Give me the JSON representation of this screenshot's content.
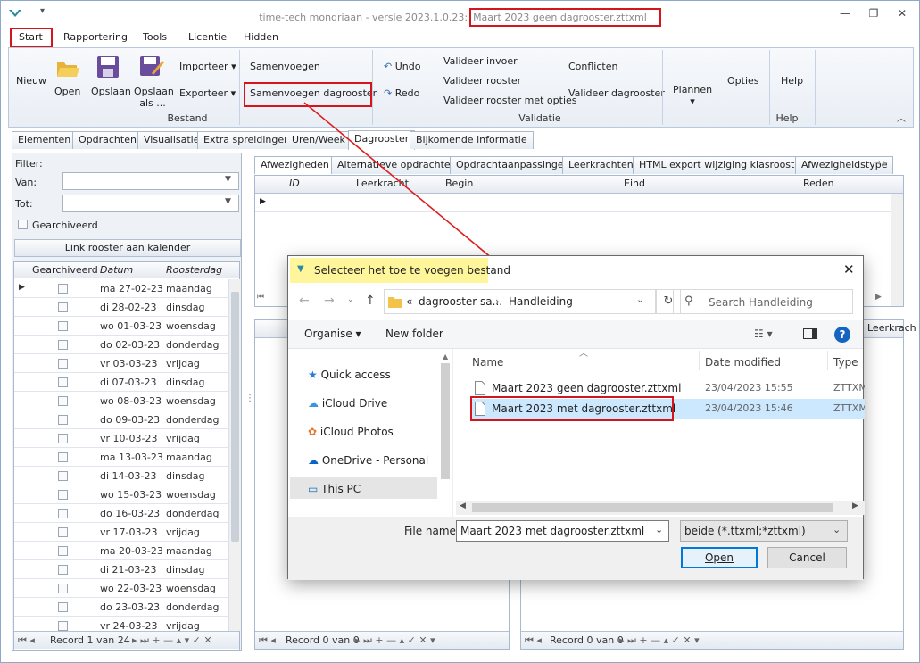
{
  "window": {
    "title": "time-tech mondriaan - versie 2023.1.0.23: Maart 2023 geen dagrooster.zttxml",
    "title_prefix": "time-tech mondriaan - versie 2023.1.0.23:",
    "title_file": "Maart 2023 geen dagrooster.zttxml",
    "minimize": "—",
    "restore": "❐",
    "close": "✕"
  },
  "menu": [
    "Start",
    "Rapportering",
    "Tools",
    "Licentie",
    "Hidden"
  ],
  "ribbon": {
    "nieuw": "Nieuw",
    "open": "Open",
    "opslaan": "Opslaan",
    "opslaan_als": "Opslaan als ...",
    "importeer": "Importeer",
    "exporteer": "Exporteer",
    "samenvoegen": "Samenvoegen",
    "samenvoegen_dagrooster": "Samenvoegen dagrooster",
    "undo": "Undo",
    "redo": "Redo",
    "valideer_invoer": "Valideer invoer",
    "valideer_rooster": "Valideer rooster",
    "valideer_opties": "Valideer rooster met opties",
    "conflicten": "Conflicten",
    "valideer_dagrooster": "Valideer dagrooster",
    "plannen": "Plannen",
    "opties": "Opties",
    "help": "Help",
    "group_bestand": "Bestand",
    "group_validatie": "Validatie",
    "group_help": "Help"
  },
  "tabs": [
    "Elementen",
    "Opdrachten",
    "Visualisatie",
    "Extra spreidingen",
    "Uren/Week",
    "Dagrooster",
    "Bijkomende informatie"
  ],
  "left": {
    "filter": "Filter:",
    "van": "Van:",
    "tot": "Tot:",
    "gearchiveerd": "Gearchiveerd",
    "link_button": "Link rooster aan kalender",
    "columns": [
      "Gearchiveerd",
      "Datum",
      "Roosterdag"
    ],
    "rows": [
      [
        "ma 27-02-23",
        "maandag"
      ],
      [
        "di 28-02-23",
        "dinsdag"
      ],
      [
        "wo 01-03-23",
        "woensdag"
      ],
      [
        "do 02-03-23",
        "donderdag"
      ],
      [
        "vr 03-03-23",
        "vrijdag"
      ],
      [
        "di 07-03-23",
        "dinsdag"
      ],
      [
        "wo 08-03-23",
        "woensdag"
      ],
      [
        "do 09-03-23",
        "donderdag"
      ],
      [
        "vr 10-03-23",
        "vrijdag"
      ],
      [
        "ma 13-03-23",
        "maandag"
      ],
      [
        "di 14-03-23",
        "dinsdag"
      ],
      [
        "wo 15-03-23",
        "woensdag"
      ],
      [
        "do 16-03-23",
        "donderdag"
      ],
      [
        "vr 17-03-23",
        "vrijdag"
      ],
      [
        "ma 20-03-23",
        "maandag"
      ],
      [
        "di 21-03-23",
        "dinsdag"
      ],
      [
        "wo 22-03-23",
        "woensdag"
      ],
      [
        "do 23-03-23",
        "donderdag"
      ],
      [
        "vr 24-03-23",
        "vrijdag"
      ]
    ],
    "record": "Record 1 van 24"
  },
  "right": {
    "tabs": [
      "Afwezigheden",
      "Alternatieve opdrachten",
      "Opdrachtaanpassingen",
      "Leerkrachten",
      "HTML export wijziging klasroosters",
      "Afwezigheidstype"
    ],
    "columns": [
      "ID",
      "Leerkracht",
      "Begin",
      "Eind",
      "Reden"
    ],
    "leerkrach": "Leerkrach",
    "record_mid": "Record 0 van 0",
    "record_right": "Record 0 van 0"
  },
  "dialog": {
    "title": "Selecteer het toe te voegen bestand",
    "close": "✕",
    "path_prefix": "«",
    "path1": "dagrooster sa...",
    "path2": "Handleiding",
    "search_placeholder": "Search Handleiding",
    "organise": "Organise",
    "new_folder": "New folder",
    "nav": [
      "Quick access",
      "iCloud Drive",
      "iCloud Photos",
      "OneDrive - Personal",
      "This PC"
    ],
    "col_name": "Name",
    "col_date": "Date modified",
    "col_type": "Type",
    "files": [
      {
        "name": "Maart 2023 geen dagrooster.zttxml",
        "date": "23/04/2023 15:55",
        "type": "ZTTXM"
      },
      {
        "name": "Maart 2023 met dagrooster.zttxml",
        "date": "23/04/2023 15:46",
        "type": "ZTTXM"
      }
    ],
    "file_name_label": "File name:",
    "file_name_value": "Maart 2023 met dagrooster.zttxml",
    "filter_value": "beide (*.ttxml;*zttxml)",
    "open": "Open",
    "cancel": "Cancel"
  },
  "colors": {
    "highlight_red": "#d4161c",
    "dialog_title_bg": "#fff59a",
    "selection_blue": "#cce8ff"
  }
}
